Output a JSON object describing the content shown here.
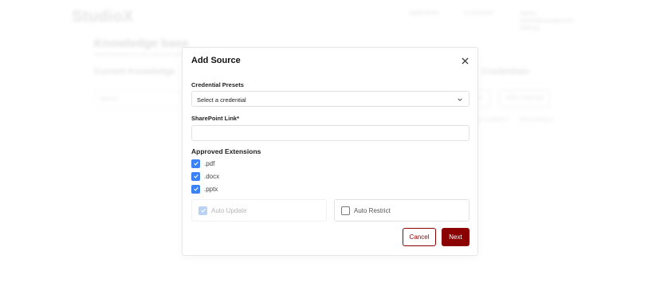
{
  "background": {
    "logo": "StudioX",
    "nav": [
      "Applications",
      "AI Assistant"
    ],
    "user_name": "Admin",
    "user_lines": [
      "admin@example.com",
      "Settings"
    ],
    "page_title": "Knowledge base",
    "page_subtitle": "Add information from your sources to get better answers",
    "section_left": "Current Knowledge",
    "section_right": "Credentials",
    "search_placeholder": "Search",
    "add_source_label": "Add Source",
    "add_credential_label": "Add Credential",
    "filter_updated": "Last updated ▾",
    "filter_sort": "Descending ▾"
  },
  "modal": {
    "title": "Add Source",
    "credential_label": "Credential Presets",
    "credential_value": "Select a credential",
    "sharepoint_label": "SharePoint Link*",
    "sharepoint_value": "",
    "extensions_title": "Approved Extensions",
    "extensions": [
      {
        "label": ".pdf",
        "checked": true
      },
      {
        "label": ".docx",
        "checked": true
      },
      {
        "label": ".pptx",
        "checked": true
      }
    ],
    "auto_update_label": "Auto Update",
    "auto_restrict_label": "Auto Restrict",
    "cancel_label": "Cancel",
    "next_label": "Next"
  },
  "colors": {
    "accent": "#8b0000",
    "checkbox": "#3b82f6",
    "checkbox_disabled": "#b9d2f6"
  },
  "icons": [
    "close-icon",
    "chevron-down-icon",
    "check-icon"
  ]
}
